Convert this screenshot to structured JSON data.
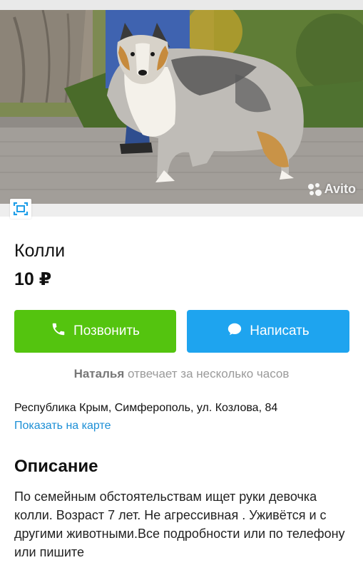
{
  "photo": {
    "watermark_text": "Avito",
    "subject": "collie dog standing on cobblestone"
  },
  "icons": {
    "expand": "expand-fullscreen-icon",
    "call": "phone-icon",
    "message": "chat-bubble-icon"
  },
  "listing": {
    "title": "Колли",
    "price": "10 ₽"
  },
  "actions": {
    "call_label": "Позвонить",
    "message_label": "Написать"
  },
  "seller": {
    "name": "Наталья",
    "response_text": "отвечает за несколько часов"
  },
  "location": {
    "address": "Республика Крым, Симферополь, ул. Козлова, 84",
    "map_link": "Показать на карте"
  },
  "description": {
    "heading": "Описание",
    "text": "По семейным обстоятельствам ищет руки девочка колли. Возраст 7 лет. Не агрессивная . Уживётся и с другими животными.Все подробности или по телефону или пишите"
  },
  "colors": {
    "call_button": "#54c40f",
    "message_button": "#1ea4ef",
    "link": "#1c8fd6",
    "muted_text": "#9a9a9a"
  }
}
